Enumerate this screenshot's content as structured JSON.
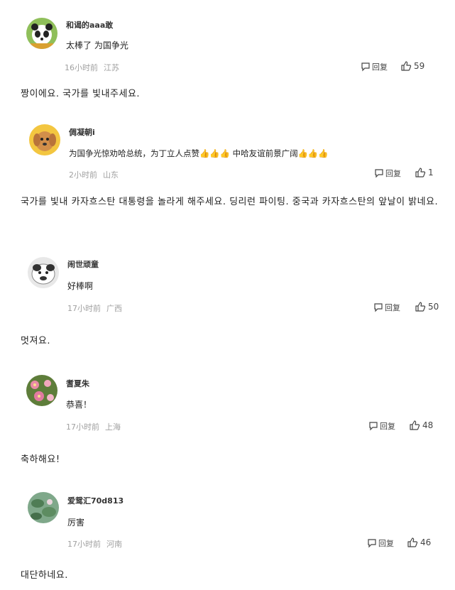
{
  "comments": [
    {
      "username": "和谒的aaa敢",
      "text": "太棒了 为国争光",
      "time": "16小时前",
      "location": "江苏",
      "reply_label": "回复",
      "likes": "59",
      "translation": "짱이에요. 국가를 빛내주세요."
    },
    {
      "username": "倜凝朝i",
      "text": "为国争光惊劝哈总统，为丁立人点赞👍👍👍 中哈友谊前景广阔👍👍👍",
      "time": "2小时前",
      "location": "山东",
      "reply_label": "回复",
      "likes": "1",
      "translation": "국가를 빛내 카자흐스탄 대통령을 놀라게 해주세요. 딩리런 파이팅. 중국과 카자흐스탄의 앞날이 밝네요."
    },
    {
      "username": "闹世顽童",
      "text": "好棒啊",
      "time": "17小时前",
      "location": "广西",
      "reply_label": "回复",
      "likes": "50",
      "translation": "멋져요."
    },
    {
      "username": "耆夏朱",
      "text": "恭喜！",
      "time": "17小时前",
      "location": "上海",
      "reply_label": "回复",
      "likes": "48",
      "translation": "축하해요!"
    },
    {
      "username": "爱鸳汇70d813",
      "text": "厉害",
      "time": "17小时前",
      "location": "河南",
      "reply_label": "回复",
      "likes": "46",
      "translation": "대단하네요."
    }
  ]
}
